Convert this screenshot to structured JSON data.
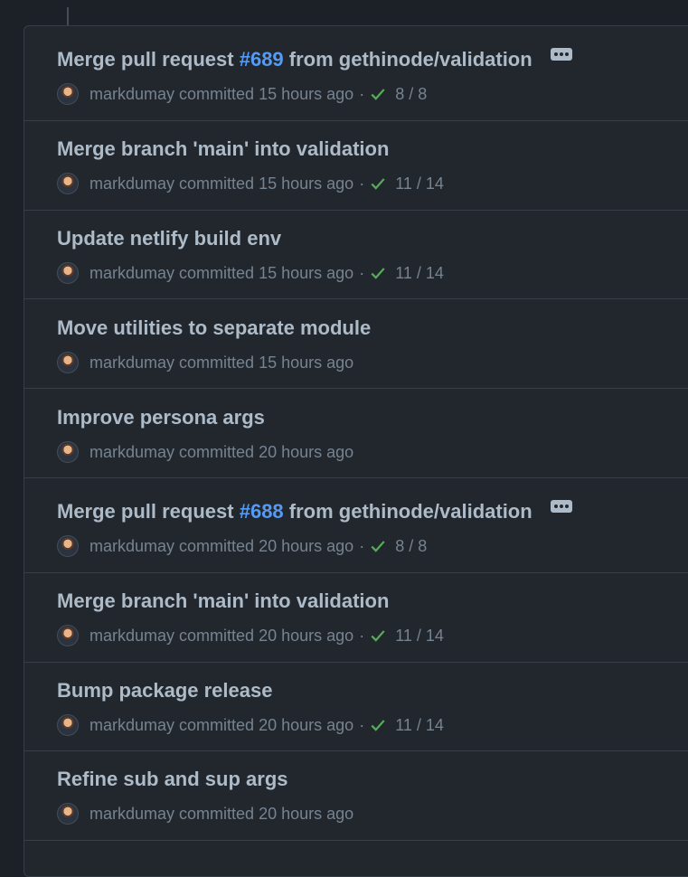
{
  "colors": {
    "background": "#1c2128",
    "panel": "#22272e",
    "title_text": "#adbac7",
    "meta_text": "#768390",
    "link": "#539bf5",
    "success": "#57ab5a",
    "border": "#373e47"
  },
  "commits": [
    {
      "title_prefix": "Merge pull request ",
      "pr_number": "#689",
      "title_suffix": " from gethinode/validation",
      "has_ellipsis": true,
      "author": "markdumay",
      "action": "committed",
      "time": "15 hours ago",
      "checks_separator": "·",
      "check_icon": "check-icon",
      "checks": "8 / 8"
    },
    {
      "title": "Merge branch 'main' into validation",
      "author": "markdumay",
      "action": "committed",
      "time": "15 hours ago",
      "checks_separator": "·",
      "check_icon": "check-icon",
      "checks": "11 / 14"
    },
    {
      "title": "Update netlify build env",
      "author": "markdumay",
      "action": "committed",
      "time": "15 hours ago",
      "checks_separator": "·",
      "check_icon": "check-icon",
      "checks": "11 / 14"
    },
    {
      "title": "Move utilities to separate module",
      "author": "markdumay",
      "action": "committed",
      "time": "15 hours ago"
    },
    {
      "title": "Improve persona args",
      "author": "markdumay",
      "action": "committed",
      "time": "20 hours ago"
    },
    {
      "title_prefix": "Merge pull request ",
      "pr_number": "#688",
      "title_suffix": " from gethinode/validation",
      "has_ellipsis": true,
      "author": "markdumay",
      "action": "committed",
      "time": "20 hours ago",
      "checks_separator": "·",
      "check_icon": "check-icon",
      "checks": "8 / 8"
    },
    {
      "title": "Merge branch 'main' into validation",
      "author": "markdumay",
      "action": "committed",
      "time": "20 hours ago",
      "checks_separator": "·",
      "check_icon": "check-icon",
      "checks": "11 / 14"
    },
    {
      "title": "Bump package release",
      "author": "markdumay",
      "action": "committed",
      "time": "20 hours ago",
      "checks_separator": "·",
      "check_icon": "check-icon",
      "checks": "11 / 14"
    },
    {
      "title": "Refine sub and sup args",
      "author": "markdumay",
      "action": "committed",
      "time": "20 hours ago"
    }
  ]
}
